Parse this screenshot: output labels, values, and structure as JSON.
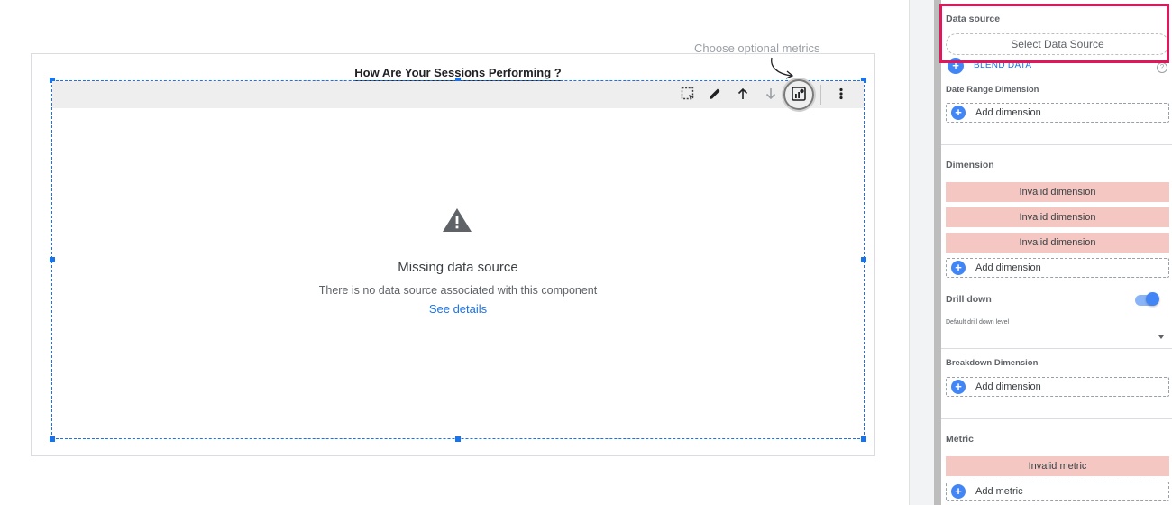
{
  "canvas": {
    "chart_title": "How Are Your Sessions Performing ?",
    "annotation": "Choose optional metrics",
    "toolbar_icons": [
      "select-region-icon",
      "edit-pencil-icon",
      "arrow-up-icon",
      "arrow-down-icon",
      "optional-metrics-icon",
      "more-vert-icon"
    ],
    "error": {
      "icon": "warning-icon",
      "title": "Missing data source",
      "description": "There is no data source associated with this component",
      "link": "See details"
    }
  },
  "panel": {
    "data_source_label": "Data source",
    "select_data_source": "Select Data Source",
    "blend_data": "BLEND DATA",
    "date_range_dimension_label": "Date Range Dimension",
    "add_dimension": "Add dimension",
    "dimension_label": "Dimension",
    "invalid_dimensions": [
      "Invalid dimension",
      "Invalid dimension",
      "Invalid dimension"
    ],
    "drill_down_label": "Drill down",
    "drill_down_enabled": true,
    "default_drill_down_level_label": "Default drill down level",
    "breakdown_dimension_label": "Breakdown Dimension",
    "metric_label": "Metric",
    "invalid_metric": "Invalid metric",
    "add_metric": "Add metric"
  },
  "colors": {
    "accent": "#1a73e8",
    "highlight": "#e3165b",
    "invalid_bg": "#f4c7c3"
  }
}
